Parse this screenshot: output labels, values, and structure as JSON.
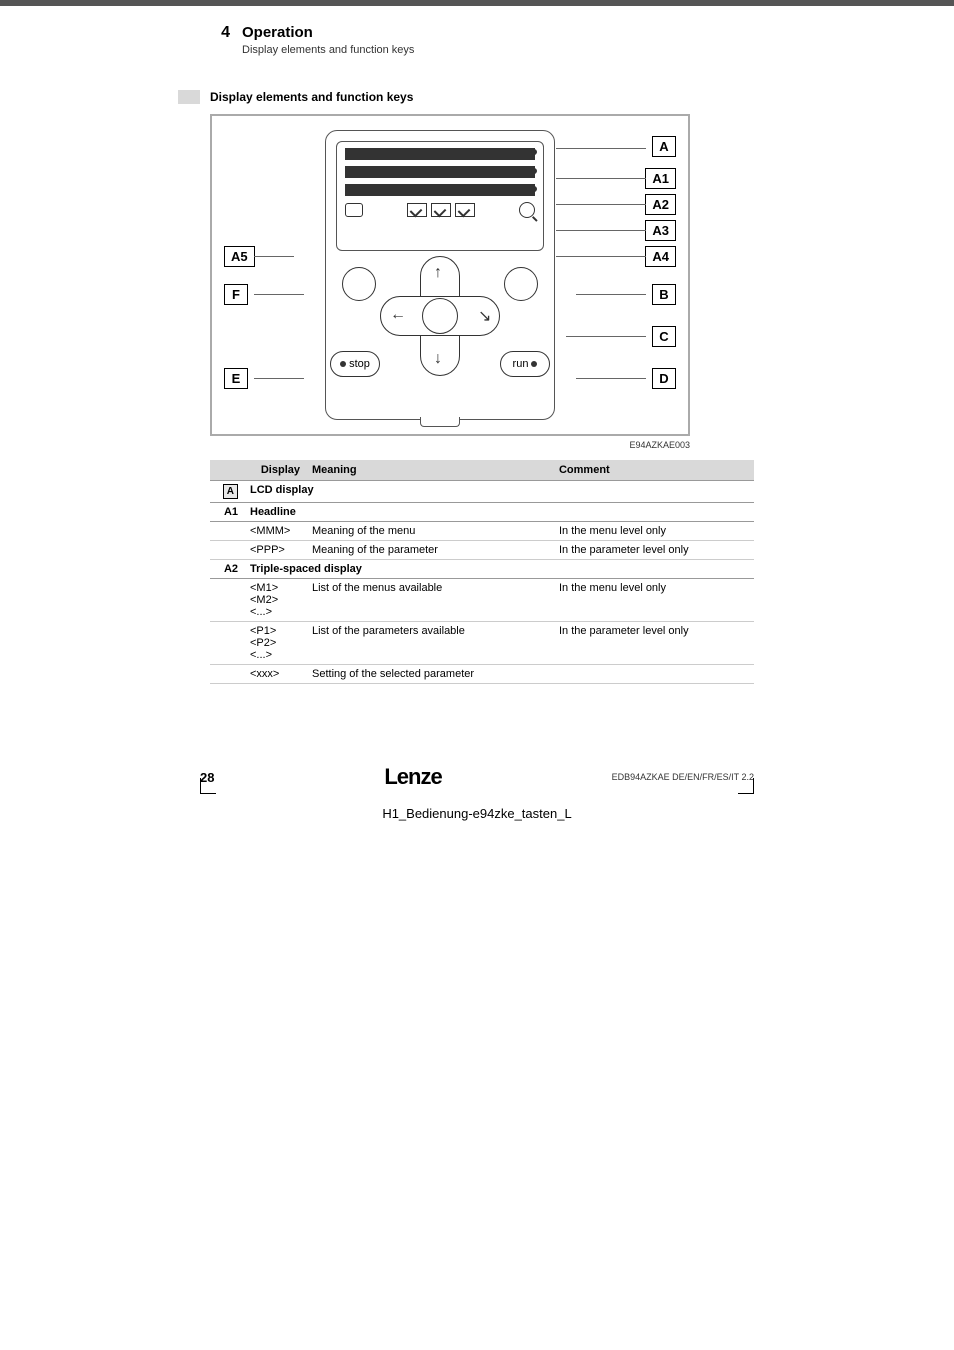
{
  "header": {
    "chapter_num": "4",
    "chapter_title": "Operation",
    "subtitle": "Display elements and function keys"
  },
  "section": {
    "title": "Display elements and function keys"
  },
  "figure": {
    "callouts": {
      "A": "A",
      "A1": "A1",
      "A2": "A2",
      "A3": "A3",
      "A4": "A4",
      "A5": "A5",
      "B": "B",
      "C": "C",
      "D": "D",
      "E": "E",
      "F": "F"
    },
    "btn_stop": "stop",
    "btn_run": "run",
    "ref": "E94AZKAE003"
  },
  "table": {
    "headers": {
      "c1": "Display",
      "c2": "Meaning",
      "c3": "Comment"
    },
    "row_A": {
      "label": "A",
      "title": "LCD display"
    },
    "row_A1": {
      "label": "A1",
      "title": "Headline",
      "rows": [
        {
          "code": "<MMM>",
          "meaning": "Meaning of the menu",
          "comment": "In the menu level only"
        },
        {
          "code": "<PPP>",
          "meaning": "Meaning of the parameter",
          "comment": "In the parameter level only"
        }
      ]
    },
    "row_A2": {
      "label": "A2",
      "title": "Triple-spaced display",
      "rows": [
        {
          "code": "<M1>\n<M2>\n<...>",
          "meaning": "List of the menus available",
          "comment": "In the menu level only"
        },
        {
          "code": "<P1>\n<P2>\n<...>",
          "meaning": "List of the parameters available",
          "comment": "In the parameter level only"
        },
        {
          "code": "<xxx>",
          "meaning": "Setting of the selected parameter",
          "comment": ""
        }
      ]
    }
  },
  "footer": {
    "page": "28",
    "logo": "Lenze",
    "docid": "EDB94AZKAE  DE/EN/FR/ES/IT  2.2"
  },
  "bottom_caption": "H1_Bedienung-e94zke_tasten_L"
}
